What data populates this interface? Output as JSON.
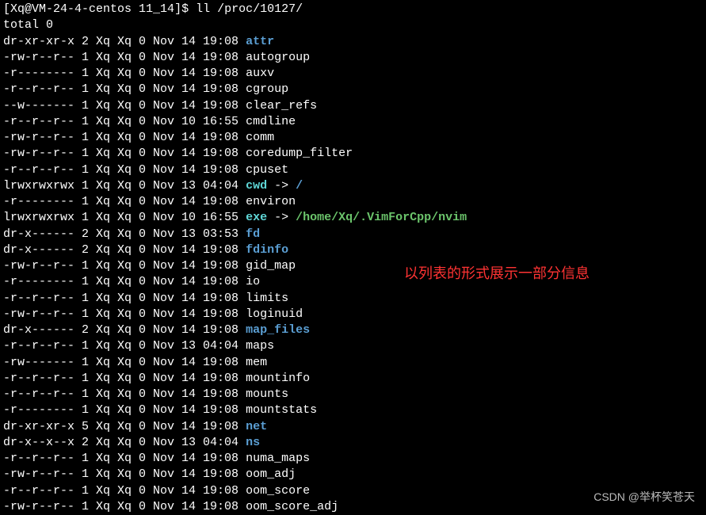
{
  "prompt": {
    "user": "Xq",
    "host": "VM-24-4-centos",
    "cwd": "11_14",
    "command": "ll /proc/10127/"
  },
  "total_line": "total 0",
  "annotation": "以列表的形式展示一部分信息",
  "watermark": "CSDN @举杯笑苍天",
  "entries": [
    {
      "perm": "dr-xr-xr-x",
      "links": "2",
      "owner": "Xq",
      "group": "Xq",
      "size": "0",
      "month": "Nov",
      "day": "14",
      "time": "19:08",
      "name": "attr",
      "type": "dir"
    },
    {
      "perm": "-rw-r--r--",
      "links": "1",
      "owner": "Xq",
      "group": "Xq",
      "size": "0",
      "month": "Nov",
      "day": "14",
      "time": "19:08",
      "name": "autogroup",
      "type": "plain"
    },
    {
      "perm": "-r--------",
      "links": "1",
      "owner": "Xq",
      "group": "Xq",
      "size": "0",
      "month": "Nov",
      "day": "14",
      "time": "19:08",
      "name": "auxv",
      "type": "plain"
    },
    {
      "perm": "-r--r--r--",
      "links": "1",
      "owner": "Xq",
      "group": "Xq",
      "size": "0",
      "month": "Nov",
      "day": "14",
      "time": "19:08",
      "name": "cgroup",
      "type": "plain"
    },
    {
      "perm": "--w-------",
      "links": "1",
      "owner": "Xq",
      "group": "Xq",
      "size": "0",
      "month": "Nov",
      "day": "14",
      "time": "19:08",
      "name": "clear_refs",
      "type": "plain"
    },
    {
      "perm": "-r--r--r--",
      "links": "1",
      "owner": "Xq",
      "group": "Xq",
      "size": "0",
      "month": "Nov",
      "day": "10",
      "time": "16:55",
      "name": "cmdline",
      "type": "plain"
    },
    {
      "perm": "-rw-r--r--",
      "links": "1",
      "owner": "Xq",
      "group": "Xq",
      "size": "0",
      "month": "Nov",
      "day": "14",
      "time": "19:08",
      "name": "comm",
      "type": "plain"
    },
    {
      "perm": "-rw-r--r--",
      "links": "1",
      "owner": "Xq",
      "group": "Xq",
      "size": "0",
      "month": "Nov",
      "day": "14",
      "time": "19:08",
      "name": "coredump_filter",
      "type": "plain"
    },
    {
      "perm": "-r--r--r--",
      "links": "1",
      "owner": "Xq",
      "group": "Xq",
      "size": "0",
      "month": "Nov",
      "day": "14",
      "time": "19:08",
      "name": "cpuset",
      "type": "plain"
    },
    {
      "perm": "lrwxrwxrwx",
      "links": "1",
      "owner": "Xq",
      "group": "Xq",
      "size": "0",
      "month": "Nov",
      "day": "13",
      "time": "04:04",
      "name": "cwd",
      "type": "link",
      "target": "/",
      "target_type": "dir"
    },
    {
      "perm": "-r--------",
      "links": "1",
      "owner": "Xq",
      "group": "Xq",
      "size": "0",
      "month": "Nov",
      "day": "14",
      "time": "19:08",
      "name": "environ",
      "type": "plain"
    },
    {
      "perm": "lrwxrwxrwx",
      "links": "1",
      "owner": "Xq",
      "group": "Xq",
      "size": "0",
      "month": "Nov",
      "day": "10",
      "time": "16:55",
      "name": "exe",
      "type": "link",
      "target": "/home/Xq/.VimForCpp/nvim",
      "target_type": "exe"
    },
    {
      "perm": "dr-x------",
      "links": "2",
      "owner": "Xq",
      "group": "Xq",
      "size": "0",
      "month": "Nov",
      "day": "13",
      "time": "03:53",
      "name": "fd",
      "type": "dir"
    },
    {
      "perm": "dr-x------",
      "links": "2",
      "owner": "Xq",
      "group": "Xq",
      "size": "0",
      "month": "Nov",
      "day": "14",
      "time": "19:08",
      "name": "fdinfo",
      "type": "dir"
    },
    {
      "perm": "-rw-r--r--",
      "links": "1",
      "owner": "Xq",
      "group": "Xq",
      "size": "0",
      "month": "Nov",
      "day": "14",
      "time": "19:08",
      "name": "gid_map",
      "type": "plain"
    },
    {
      "perm": "-r--------",
      "links": "1",
      "owner": "Xq",
      "group": "Xq",
      "size": "0",
      "month": "Nov",
      "day": "14",
      "time": "19:08",
      "name": "io",
      "type": "plain"
    },
    {
      "perm": "-r--r--r--",
      "links": "1",
      "owner": "Xq",
      "group": "Xq",
      "size": "0",
      "month": "Nov",
      "day": "14",
      "time": "19:08",
      "name": "limits",
      "type": "plain"
    },
    {
      "perm": "-rw-r--r--",
      "links": "1",
      "owner": "Xq",
      "group": "Xq",
      "size": "0",
      "month": "Nov",
      "day": "14",
      "time": "19:08",
      "name": "loginuid",
      "type": "plain"
    },
    {
      "perm": "dr-x------",
      "links": "2",
      "owner": "Xq",
      "group": "Xq",
      "size": "0",
      "month": "Nov",
      "day": "14",
      "time": "19:08",
      "name": "map_files",
      "type": "dir"
    },
    {
      "perm": "-r--r--r--",
      "links": "1",
      "owner": "Xq",
      "group": "Xq",
      "size": "0",
      "month": "Nov",
      "day": "13",
      "time": "04:04",
      "name": "maps",
      "type": "plain"
    },
    {
      "perm": "-rw-------",
      "links": "1",
      "owner": "Xq",
      "group": "Xq",
      "size": "0",
      "month": "Nov",
      "day": "14",
      "time": "19:08",
      "name": "mem",
      "type": "plain"
    },
    {
      "perm": "-r--r--r--",
      "links": "1",
      "owner": "Xq",
      "group": "Xq",
      "size": "0",
      "month": "Nov",
      "day": "14",
      "time": "19:08",
      "name": "mountinfo",
      "type": "plain"
    },
    {
      "perm": "-r--r--r--",
      "links": "1",
      "owner": "Xq",
      "group": "Xq",
      "size": "0",
      "month": "Nov",
      "day": "14",
      "time": "19:08",
      "name": "mounts",
      "type": "plain"
    },
    {
      "perm": "-r--------",
      "links": "1",
      "owner": "Xq",
      "group": "Xq",
      "size": "0",
      "month": "Nov",
      "day": "14",
      "time": "19:08",
      "name": "mountstats",
      "type": "plain"
    },
    {
      "perm": "dr-xr-xr-x",
      "links": "5",
      "owner": "Xq",
      "group": "Xq",
      "size": "0",
      "month": "Nov",
      "day": "14",
      "time": "19:08",
      "name": "net",
      "type": "dir"
    },
    {
      "perm": "dr-x--x--x",
      "links": "2",
      "owner": "Xq",
      "group": "Xq",
      "size": "0",
      "month": "Nov",
      "day": "13",
      "time": "04:04",
      "name": "ns",
      "type": "dir"
    },
    {
      "perm": "-r--r--r--",
      "links": "1",
      "owner": "Xq",
      "group": "Xq",
      "size": "0",
      "month": "Nov",
      "day": "14",
      "time": "19:08",
      "name": "numa_maps",
      "type": "plain"
    },
    {
      "perm": "-rw-r--r--",
      "links": "1",
      "owner": "Xq",
      "group": "Xq",
      "size": "0",
      "month": "Nov",
      "day": "14",
      "time": "19:08",
      "name": "oom_adj",
      "type": "plain"
    },
    {
      "perm": "-r--r--r--",
      "links": "1",
      "owner": "Xq",
      "group": "Xq",
      "size": "0",
      "month": "Nov",
      "day": "14",
      "time": "19:08",
      "name": "oom_score",
      "type": "plain"
    },
    {
      "perm": "-rw-r--r--",
      "links": "1",
      "owner": "Xq",
      "group": "Xq",
      "size": "0",
      "month": "Nov",
      "day": "14",
      "time": "19:08",
      "name": "oom_score_adj",
      "type": "plain"
    }
  ]
}
